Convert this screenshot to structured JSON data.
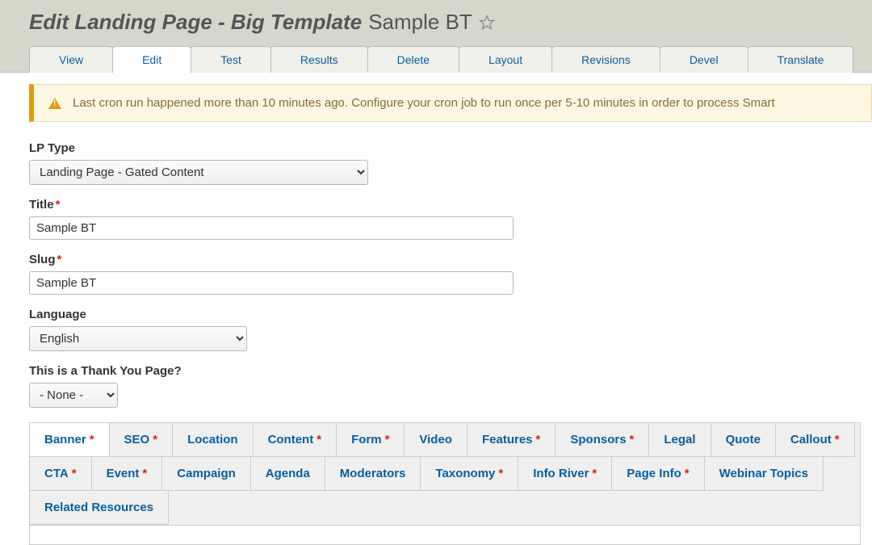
{
  "header": {
    "title_prefix": "Edit Landing Page - Big Template",
    "title_name": "Sample BT"
  },
  "tabs": [
    {
      "label": "View",
      "active": false
    },
    {
      "label": "Edit",
      "active": true
    },
    {
      "label": "Test",
      "active": false
    },
    {
      "label": "Results",
      "active": false
    },
    {
      "label": "Delete",
      "active": false
    },
    {
      "label": "Layout",
      "active": false
    },
    {
      "label": "Revisions",
      "active": false
    },
    {
      "label": "Devel",
      "active": false
    },
    {
      "label": "Translate",
      "active": false
    }
  ],
  "warning": "Last cron run happened more than 10 minutes ago. Configure your cron job to run once per 5-10 minutes in order to process Smart",
  "form": {
    "lp_type": {
      "label": "LP Type",
      "value": "Landing Page - Gated Content"
    },
    "title": {
      "label": "Title",
      "value": "Sample BT",
      "required": true
    },
    "slug": {
      "label": "Slug",
      "value": "Sample BT",
      "required": true
    },
    "language": {
      "label": "Language",
      "value": "English"
    },
    "thank_you": {
      "label": "This is a Thank You Page?",
      "value": "- None -"
    }
  },
  "sub_tabs": [
    {
      "label": "Banner",
      "required": true,
      "active": true
    },
    {
      "label": "SEO",
      "required": true
    },
    {
      "label": "Location"
    },
    {
      "label": "Content",
      "required": true
    },
    {
      "label": "Form",
      "required": true
    },
    {
      "label": "Video"
    },
    {
      "label": "Features",
      "required": true
    },
    {
      "label": "Sponsors",
      "required": true
    },
    {
      "label": "Legal"
    },
    {
      "label": "Quote"
    },
    {
      "label": "Callout",
      "required": true
    },
    {
      "label": "CTA",
      "required": true
    },
    {
      "label": "Event",
      "required": true
    },
    {
      "label": "Campaign"
    },
    {
      "label": "Agenda"
    },
    {
      "label": "Moderators"
    },
    {
      "label": "Taxonomy",
      "required": true
    },
    {
      "label": "Info River",
      "required": true
    },
    {
      "label": "Page Info",
      "required": true
    },
    {
      "label": "Webinar Topics"
    },
    {
      "label": "Related Resources"
    }
  ]
}
